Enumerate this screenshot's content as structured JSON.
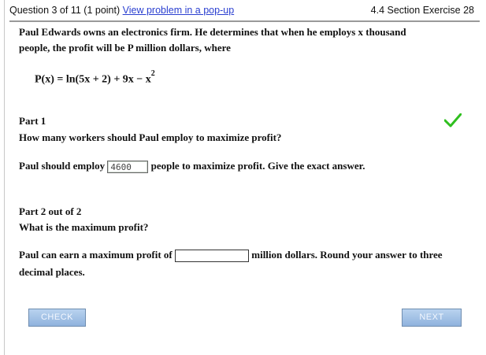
{
  "header": {
    "question_label": "Question 3 of 11 (1 point)",
    "popup_link": "View problem in a pop-up",
    "section_label": "4.4 Section Exercise 28"
  },
  "problem": {
    "line1": "Paul Edwards owns an electronics firm. He determines that when he employs x thousand",
    "line2": "people, the profit will be P million dollars, where",
    "formula": "P(x) = ln(5x + 2) + 9x − x",
    "formula_exponent": "2"
  },
  "part1": {
    "title": "Part 1",
    "question": "How many workers should Paul employ to maximize profit?",
    "answer_prefix": "Paul should employ",
    "answer_value": "4600",
    "answer_suffix": "people to maximize profit. Give the exact answer.",
    "status_icon": "green-check-icon",
    "status_color": "#2fbf1f"
  },
  "part2": {
    "title": "Part 2 out of 2",
    "question": "What is the maximum profit?",
    "answer_prefix": "Paul can earn a maximum profit of",
    "answer_value": "",
    "answer_suffix_line1": "million dollars. Round your answer to three",
    "answer_suffix_line2": "decimal places."
  },
  "buttons": {
    "check_label": "CHECK",
    "next_label": "NEXT"
  }
}
